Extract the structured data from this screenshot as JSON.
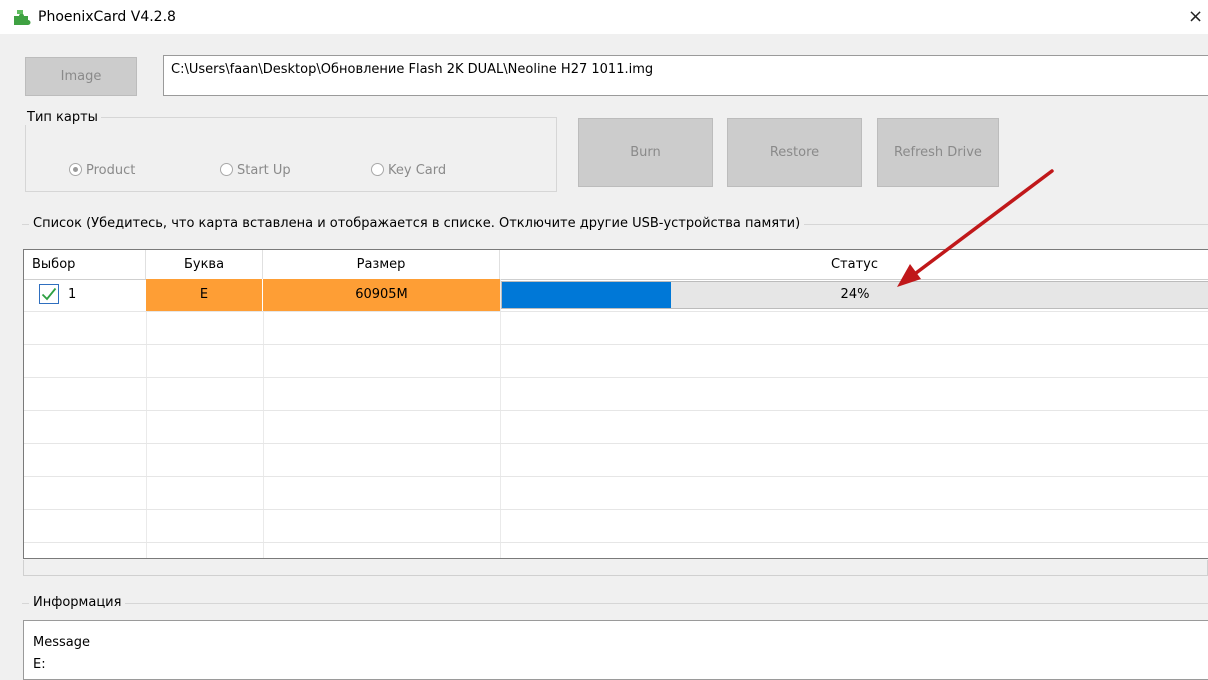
{
  "window": {
    "title": "PhoenixCard V4.2.8",
    "close_glyph": "×"
  },
  "toolbar": {
    "image_button": "Image",
    "image_path": "C:\\Users\\faan\\Desktop\\Обновление Flash 2K DUAL\\Neoline H27 1011.img"
  },
  "card_type": {
    "legend": "Тип карты",
    "options": [
      {
        "label": "Product",
        "selected": true
      },
      {
        "label": "Start Up",
        "selected": false
      },
      {
        "label": "Key Card",
        "selected": false
      }
    ]
  },
  "actions": {
    "burn": "Burn",
    "restore": "Restore",
    "refresh": "Refresh Drive"
  },
  "list": {
    "legend": "Список (Убедитесь, что карта вставлена и отображается в списке. Отключите другие USB-устройства памяти)",
    "columns": [
      "Выбор",
      "Буква",
      "Размер",
      "Статус"
    ],
    "rows": [
      {
        "selected": true,
        "index": "1",
        "letter": "E",
        "size": "60905M",
        "status": "24%",
        "progress": 0.24
      }
    ]
  },
  "info": {
    "legend": "Информация",
    "lines": [
      "Message",
      "E:"
    ]
  },
  "colors": {
    "highlight": "#fe9e35",
    "progress": "#0078d7",
    "annotation_arrow": "#c0181a"
  },
  "icons": {
    "app": "puzzle-icon",
    "check": "checkmark-icon",
    "annotation": "red-arrow-icon"
  }
}
